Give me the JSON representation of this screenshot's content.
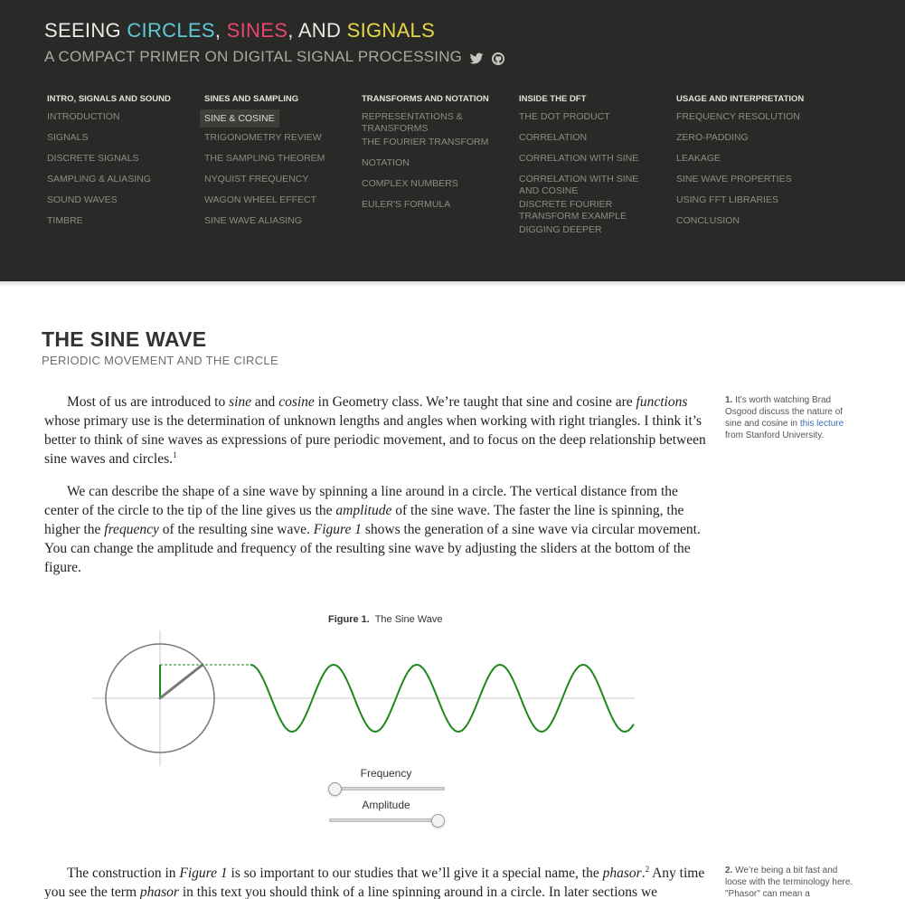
{
  "site": {
    "title_part1": "SEEING ",
    "title_circles": "CIRCLES",
    "title_comma": ",",
    "title_sines": "SINES",
    "title_and": ", AND",
    "title_signals": "SIGNALS",
    "subtitle": "A COMPACT PRIMER ON DIGITAL SIGNAL PROCESSING",
    "social_icons": [
      "twitter-icon",
      "github-icon"
    ],
    "colors": {
      "header_bg": "#292927",
      "circles": "#5fc8d6",
      "sines": "#e8466d",
      "signals": "#e6d64a",
      "wave": "#1b8a1b"
    }
  },
  "nav": [
    {
      "heading": "INTRO, SIGNALS AND SOUND",
      "items": [
        "INTRODUCTION",
        "SIGNALS",
        "DISCRETE SIGNALS",
        "SAMPLING & ALIASING",
        "SOUND WAVES",
        "TIMBRE"
      ]
    },
    {
      "heading": "SINES AND SAMPLING",
      "items": [
        "SINE & COSINE",
        "TRIGONOMETRY REVIEW",
        "THE SAMPLING THEOREM",
        "NYQUIST FREQUENCY",
        "WAGON WHEEL EFFECT",
        "SINE WAVE ALIASING"
      ]
    },
    {
      "heading": "TRANSFORMS AND NOTATION",
      "items": [
        "REPRESENTATIONS & TRANSFORMS",
        "THE FOURIER TRANSFORM",
        "NOTATION",
        "COMPLEX NUMBERS",
        "EULER'S FORMULA"
      ]
    },
    {
      "heading": "INSIDE THE DFT",
      "items": [
        "THE DOT PRODUCT",
        "CORRELATION",
        "CORRELATION WITH SINE",
        "CORRELATION WITH SINE AND COSINE",
        "DISCRETE FOURIER TRANSFORM EXAMPLE",
        "DIGGING DEEPER"
      ]
    },
    {
      "heading": "USAGE AND INTERPRETATION",
      "items": [
        "FREQUENCY RESOLUTION",
        "ZERO-PADDING",
        "LEAKAGE",
        "SINE WAVE PROPERTIES",
        "USING FFT LIBRARIES",
        "CONCLUSION"
      ]
    }
  ],
  "nav_active": "SINE & COSINE",
  "article": {
    "title": "THE SINE WAVE",
    "subtitle": "PERIODIC MOVEMENT AND THE CIRCLE",
    "p1": {
      "a": "Most of us are introduced to ",
      "sine": "sine",
      "b": " and ",
      "cosine": "cosine",
      "c": " in Geometry class. We’re taught that sine and cosine are ",
      "functions": "functions",
      "d": " whose primary use is the determination of unknown lengths and angles when working with right triangles. I think it’s better to think of sine waves as expressions of pure periodic movement, and to focus on the deep relationship between sine waves and circles.",
      "note": "1"
    },
    "p2": {
      "a": "We can describe the shape of a sine wave by spinning a line around in a circle. The vertical distance from the center of the circle to the tip of the line gives us the ",
      "amplitude": "amplitude",
      "b": " of the sine wave. The faster the line is spinning, the higher the ",
      "frequency": "frequency",
      "c": " of the resulting sine wave. ",
      "figref": "Figure 1",
      "d": " shows the generation of a sine wave via circular movement. You can change the amplitude and frequency of the resulting sine wave by adjusting the sliders at the bottom of the figure."
    },
    "p3": {
      "a": "The construction in ",
      "figref": "Figure 1",
      "b": " is so important to our studies that we’ll give it a special name, the ",
      "phasor": "phasor",
      "c": ".",
      "note": "2",
      "d": " Any time you see the term ",
      "phasor2": "phasor",
      "e": " in this text you should think of a line spinning around in a circle. In later sections we"
    }
  },
  "sidenotes": {
    "n1": {
      "num": "1.",
      "text": " It’s worth watching Brad Osgood discuss the nature of sine and cosine in ",
      "link": "this lecture",
      "after": " from Stanford University."
    },
    "n2": {
      "num": "2.",
      "text": " We’re being a bit fast and loose with the terminology here. \"Phasor\" can mean a"
    }
  },
  "figure": {
    "label": "Figure 1.",
    "title": "The Sine Wave",
    "frequency_label": "Frequency",
    "amplitude_label": "Amplitude",
    "frequency_value": 0.05,
    "amplitude_value": 1.0
  }
}
